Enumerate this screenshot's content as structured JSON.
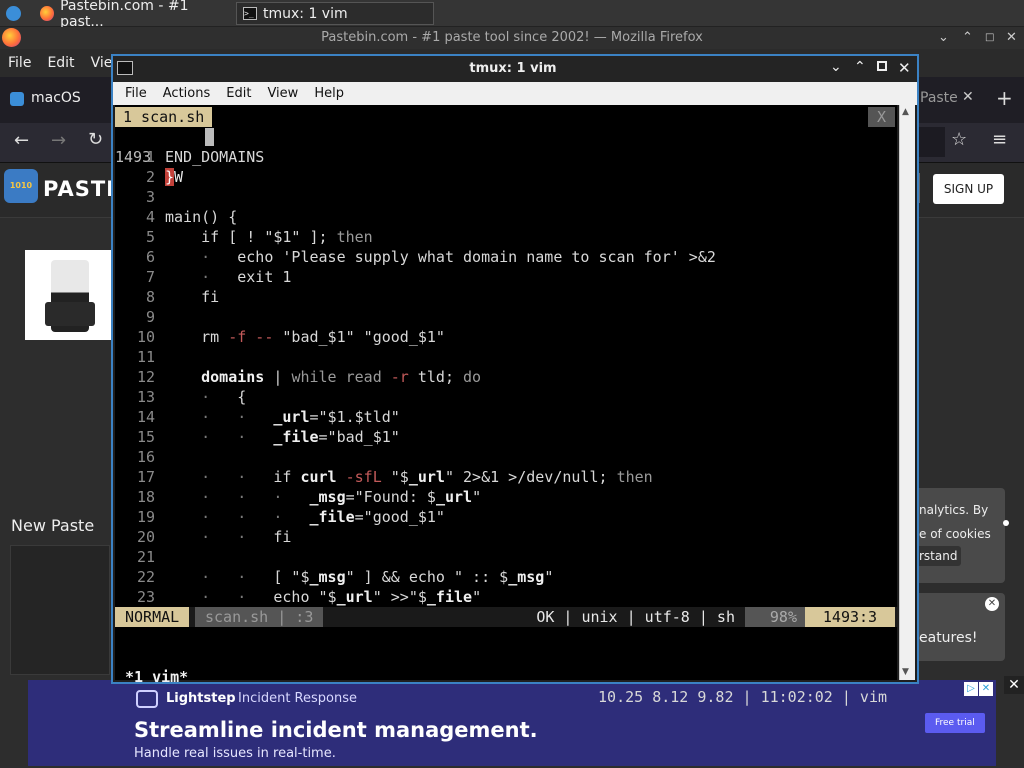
{
  "panel": {
    "firefox_tab": "Pastebin.com - #1 past...",
    "tmux_tab": "tmux: 1 vim"
  },
  "firefox": {
    "window_title": "Pastebin.com - #1 paste tool since 2002! — Mozilla Firefox",
    "menu": [
      "File",
      "Edit",
      "View"
    ],
    "tab_left": "macOS",
    "tab_right": "Paste",
    "site_logo_text": "PASTE",
    "signup": "SIGN UP",
    "new_paste": "New Paste",
    "cookie_text": [
      "nalytics. By",
      "e of cookies",
      "rstand"
    ],
    "features_text": "eatures!",
    "ad": {
      "brand": "Lightstep",
      "product": "Incident Response",
      "headline": "Streamline incident management.",
      "sub": "Handle real issues in real-time.",
      "cta": "Free trial"
    }
  },
  "tmux": {
    "title": "tmux: 1 vim",
    "menu": [
      "File",
      "Actions",
      "Edit",
      "View",
      "Help"
    ]
  },
  "vim": {
    "tab_label": "1 scan.sh",
    "tab_close": "X",
    "current_line_no": "1493",
    "current_line_text": "ZW",
    "mode": "NORMAL",
    "file_info": "scan.sh | :3",
    "status_right": "OK | unix | utf-8 | sh",
    "percent": "98%",
    "position": "1493:3",
    "tmux_status_left": "*1 vim*",
    "tmux_status_right": "10.25 8.12 9.82 | 11:02:02 | vim"
  },
  "code_lines": [
    {
      "n": "1",
      "t": "END_DOMAINS"
    },
    {
      "n": "2",
      "t": "}"
    },
    {
      "n": "3",
      "t": ""
    },
    {
      "n": "4",
      "t": "main() {"
    },
    {
      "n": "5",
      "t": "    if [ ! \"$1\" ]; then"
    },
    {
      "n": "6",
      "t": "    ·   echo 'Please supply what domain name to scan for' >&2"
    },
    {
      "n": "7",
      "t": "    ·   exit 1"
    },
    {
      "n": "8",
      "t": "    fi"
    },
    {
      "n": "9",
      "t": ""
    },
    {
      "n": "10",
      "t": "    rm -f -- \"bad_$1\" \"good_$1\""
    },
    {
      "n": "11",
      "t": ""
    },
    {
      "n": "12",
      "t": "    domains | while read -r tld; do"
    },
    {
      "n": "13",
      "t": "    ·   {"
    },
    {
      "n": "14",
      "t": "    ·   ·   _url=\"$1.$tld\""
    },
    {
      "n": "15",
      "t": "    ·   ·   _file=\"bad_$1\""
    },
    {
      "n": "16",
      "t": ""
    },
    {
      "n": "17",
      "t": "    ·   ·   if curl -sfL \"$_url\" 2>&1 >/dev/null; then"
    },
    {
      "n": "18",
      "t": "    ·   ·   ·   _msg=\"Found: $_url\""
    },
    {
      "n": "19",
      "t": "    ·   ·   ·   _file=\"good_$1\""
    },
    {
      "n": "20",
      "t": "    ·   ·   fi"
    },
    {
      "n": "21",
      "t": ""
    },
    {
      "n": "22",
      "t": "    ·   ·   [ \"$_msg\" ] && echo \" :: $_msg\""
    },
    {
      "n": "23",
      "t": "    ·   ·   echo \"$_url\" >>\"$_file\""
    }
  ]
}
